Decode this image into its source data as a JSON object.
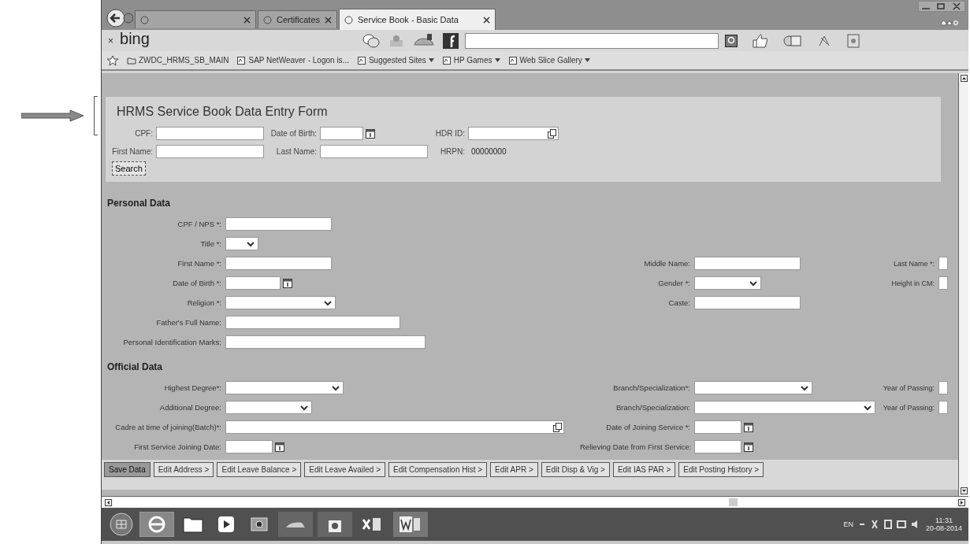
{
  "browser": {
    "tabs": [
      {
        "selected": false
      },
      {
        "label": "Certificates",
        "selected": false
      },
      {
        "label": "Service Book - Basic Data",
        "selected": true
      }
    ],
    "toolbar": {
      "close": "×",
      "brand": "bing"
    },
    "favorites": [
      {
        "label": "ZWDC_HRMS_SB_MAIN",
        "menu": false
      },
      {
        "label": "SAP NetWeaver - Logon is...",
        "menu": false
      },
      {
        "label": "Suggested Sites",
        "menu": true
      },
      {
        "label": "HP Games",
        "menu": true
      },
      {
        "label": "Web Slice Gallery",
        "menu": true
      }
    ]
  },
  "form": {
    "title": "HRMS Service Book Data Entry Form",
    "search_fields": [
      {
        "label": "CPF:",
        "kind": "text"
      },
      {
        "label": "Date of Birth:",
        "kind": "date"
      },
      {
        "label": "HDR ID:",
        "kind": "lookup"
      },
      {
        "label": "First Name:",
        "kind": "text"
      },
      {
        "label": "Last Name:",
        "kind": "text"
      },
      {
        "label": "HRPN:",
        "kind": "readout",
        "value": "00000000"
      }
    ],
    "search_button": "Search"
  },
  "sections": [
    {
      "title": "Personal Data",
      "rows": [
        {
          "left": {
            "label": "CPF / NPS *:",
            "kind": "text"
          }
        },
        {
          "left": {
            "label": "Title *:",
            "kind": "select"
          }
        },
        {
          "left": {
            "label": "First Name *:",
            "kind": "text"
          },
          "right": {
            "label": "Middle Name:",
            "kind": "text"
          },
          "far": {
            "label": "Last Name *:",
            "kind": "text"
          }
        },
        {
          "left": {
            "label": "Date of Birth *:",
            "kind": "date"
          },
          "right": {
            "label": "Gender *:",
            "kind": "select"
          },
          "far": {
            "label": "Height in CM:",
            "kind": "text"
          }
        },
        {
          "left": {
            "label": "Religion *:",
            "kind": "select"
          },
          "right": {
            "label": "Caste:",
            "kind": "text"
          }
        },
        {
          "left": {
            "label": "Father's Full Name:",
            "kind": "text"
          }
        },
        {
          "left": {
            "label": "Personal Identification Marks:",
            "kind": "text"
          }
        }
      ]
    },
    {
      "title": "Official Data",
      "rows": [
        {
          "left": {
            "label": "Highest Degree*:",
            "kind": "select"
          },
          "right": {
            "label": "Branch/Specialization*:",
            "kind": "select"
          },
          "far": {
            "label": "Year of Passing:",
            "kind": "text"
          }
        },
        {
          "left": {
            "label": "Additional Degree:",
            "kind": "select"
          },
          "right": {
            "label": "Branch/Specialization:",
            "kind": "select"
          },
          "far": {
            "label": "Year of Passing:",
            "kind": "text"
          }
        },
        {
          "left": {
            "label": "Cadre at time of joining(Batch)*:",
            "kind": "lookup"
          },
          "right": {
            "label": "Date of Joining Service *:",
            "kind": "date"
          }
        },
        {
          "left": {
            "label": "First Service Joining Date:",
            "kind": "date"
          },
          "right": {
            "label": "Relieving Date from First Service:",
            "kind": "date"
          }
        }
      ]
    }
  ],
  "buttons": [
    {
      "label": "Save Data",
      "kind": "primary"
    },
    {
      "label": "Edit Address >",
      "kind": "plain"
    },
    {
      "label": "Edit Leave Balance >",
      "kind": "plain"
    },
    {
      "label": "Edit Leave Availed >",
      "kind": "plain"
    },
    {
      "label": "Edit Compensation Hist >",
      "kind": "plain"
    },
    {
      "label": "Edit APR >",
      "kind": "plain"
    },
    {
      "label": "Edit Disp & Vig >",
      "kind": "plain"
    },
    {
      "label": "Edit IAS PAR >",
      "kind": "plain"
    },
    {
      "label": "Edit Posting History >",
      "kind": "plain"
    }
  ],
  "taskbar": {
    "language": "EN",
    "time": "11:31",
    "date": "20-08-2014"
  }
}
